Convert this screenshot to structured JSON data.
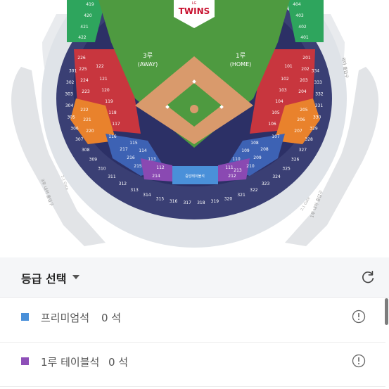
{
  "map": {
    "logo_small": "LG",
    "logo_text": "TWINS",
    "third_base": {
      "label": "3루",
      "sub": "(AWAY)"
    },
    "first_base": {
      "label": "1루",
      "sub": "(HOME)"
    },
    "center_label": "중앙테이블석",
    "left_exit": "3루 내야 출입구",
    "right_exit": "1루 내야 출입구",
    "gate_left": "2.1 Gate",
    "gate_right": "2.1 Gate",
    "right_top_badge": "외야 출입구",
    "outfield_left": [
      "419",
      "420",
      "421",
      "422"
    ],
    "outfield_right": [
      "404",
      "403",
      "402",
      "401"
    ],
    "red_left": [
      "226",
      "225",
      "224",
      "223",
      "122",
      "121",
      "120",
      "119",
      "118",
      "117"
    ],
    "red_right": [
      "201",
      "202",
      "203",
      "204",
      "101",
      "102",
      "103",
      "104",
      "105",
      "106"
    ],
    "orange_left": [
      "222",
      "221",
      "220",
      "116"
    ],
    "orange_right": [
      "205",
      "206",
      "207",
      "107"
    ],
    "blue_left": [
      "115",
      "114",
      "113",
      "217",
      "216",
      "215"
    ],
    "blue_right": [
      "108",
      "109",
      "110",
      "208",
      "209",
      "210"
    ],
    "purple_left": [
      "112",
      "214"
    ],
    "purple_right": [
      "111",
      "213",
      "212"
    ],
    "navy_outer": [
      "334",
      "333",
      "332",
      "331",
      "330",
      "329",
      "328",
      "327",
      "326",
      "325",
      "324",
      "323",
      "322",
      "321",
      "320",
      "319",
      "318",
      "317",
      "316",
      "315",
      "314",
      "313",
      "312",
      "311",
      "310",
      "309",
      "308",
      "307",
      "306",
      "305",
      "304",
      "303",
      "302",
      "301"
    ]
  },
  "panel": {
    "header_title": "등급 선택",
    "refresh_icon": "refresh-icon",
    "grades": [
      {
        "name": "프리미엄석",
        "count": "0 석",
        "color": "#4a90d9"
      },
      {
        "name": "1루 테이블석",
        "count": "0 석",
        "color": "#8e4fb8"
      }
    ]
  }
}
